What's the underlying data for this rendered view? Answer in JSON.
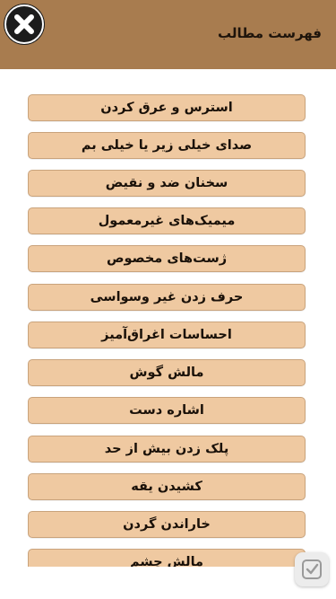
{
  "header": {
    "title": "فهرست مطالب",
    "close_icon": "close-icon"
  },
  "menu": {
    "items": [
      {
        "label": "استرس و عرق کردن"
      },
      {
        "label": "صدای خیلی زیر یا خیلی بم"
      },
      {
        "label": "سخنان ضد و نقیض"
      },
      {
        "label": "میمیک‌های غیرمعمول"
      },
      {
        "label": "ژست‌های مخصوص"
      },
      {
        "label": "حرف زدن غیر وسواسی"
      },
      {
        "label": "احساسات اغراق‌آمیز"
      },
      {
        "label": "مالش گوش"
      },
      {
        "label": "اشاره دست"
      },
      {
        "label": "پلک زدن بیش از حد"
      },
      {
        "label": "کشیدن یقه"
      },
      {
        "label": "خاراندن گردن"
      },
      {
        "label": "مالش چشم"
      }
    ]
  },
  "colors": {
    "header_bg": "#a87c4f",
    "item_bg": "#efc9a1",
    "item_border": "#c9a37c"
  },
  "floating_action": {
    "icon": "checkmark-icon"
  }
}
